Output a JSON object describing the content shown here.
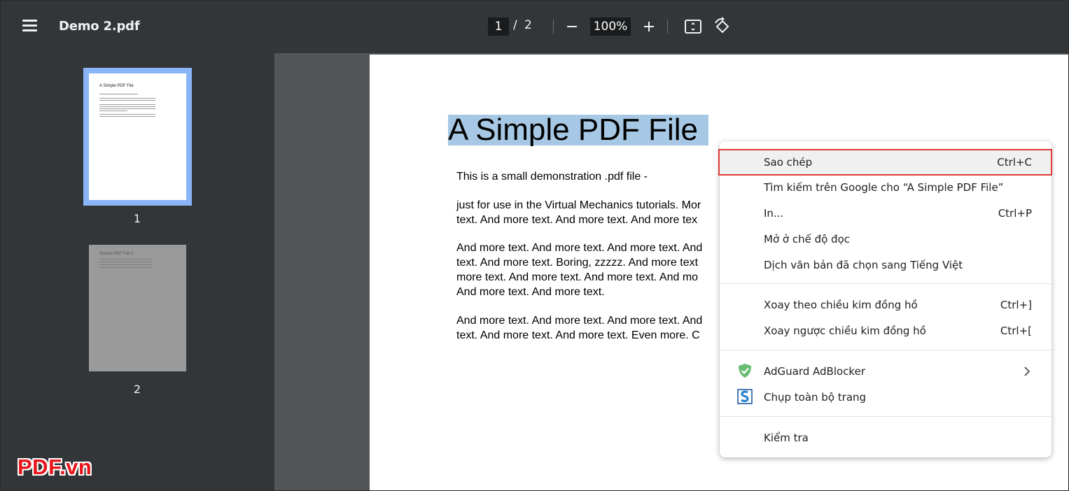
{
  "toolbar": {
    "title": "Demo 2.pdf",
    "current_page": "1",
    "page_separator": "/",
    "total_pages": "2",
    "zoom": "100%"
  },
  "sidebar": {
    "thumbnails": [
      {
        "number": "1",
        "title": "A Simple PDF File"
      },
      {
        "number": "2",
        "title": "Simple PDF File 2"
      }
    ]
  },
  "document": {
    "title": "A Simple PDF File",
    "paragraphs": [
      "This is a small demonstration .pdf file -",
      "just for use in the Virtual Mechanics tutorials. Mor\ntext. And more text. And more text. And more tex",
      "And more text. And more text. And more text. And\ntext. And more text. Boring, zzzzz. And more text\nmore text. And more text. And more text. And mo\nAnd more text. And more text.",
      "And more text. And more text. And more text. And\ntext. And more text. And more text. Even more. C"
    ]
  },
  "context_menu": {
    "items": [
      {
        "label": "Sao chép",
        "shortcut": "Ctrl+C"
      },
      {
        "label": "Tìm kiếm trên Google cho “A Simple PDF File”",
        "shortcut": ""
      },
      {
        "label": "In...",
        "shortcut": "Ctrl+P"
      },
      {
        "label": "Mở ở chế độ đọc",
        "shortcut": ""
      },
      {
        "label": "Dịch văn bản đã chọn sang Tiếng Việt",
        "shortcut": ""
      },
      {
        "label": "Xoay theo chiều kim đồng hồ",
        "shortcut": "Ctrl+]"
      },
      {
        "label": "Xoay ngược chiều kim đồng hồ",
        "shortcut": "Ctrl+["
      },
      {
        "label": "AdGuard AdBlocker",
        "shortcut": ""
      },
      {
        "label": "Chụp toàn bộ trang",
        "shortcut": ""
      },
      {
        "label": "Kiểm tra",
        "shortcut": ""
      }
    ]
  },
  "watermark": {
    "text": "PDF.vn"
  },
  "colors": {
    "toolbar_bg": "#323639",
    "viewer_bg": "#525659",
    "thumb_selected": "#8ab4f8",
    "selection": "#a6c8e4",
    "highlight_border": "#e03a3a",
    "watermark": "#e8161c"
  }
}
